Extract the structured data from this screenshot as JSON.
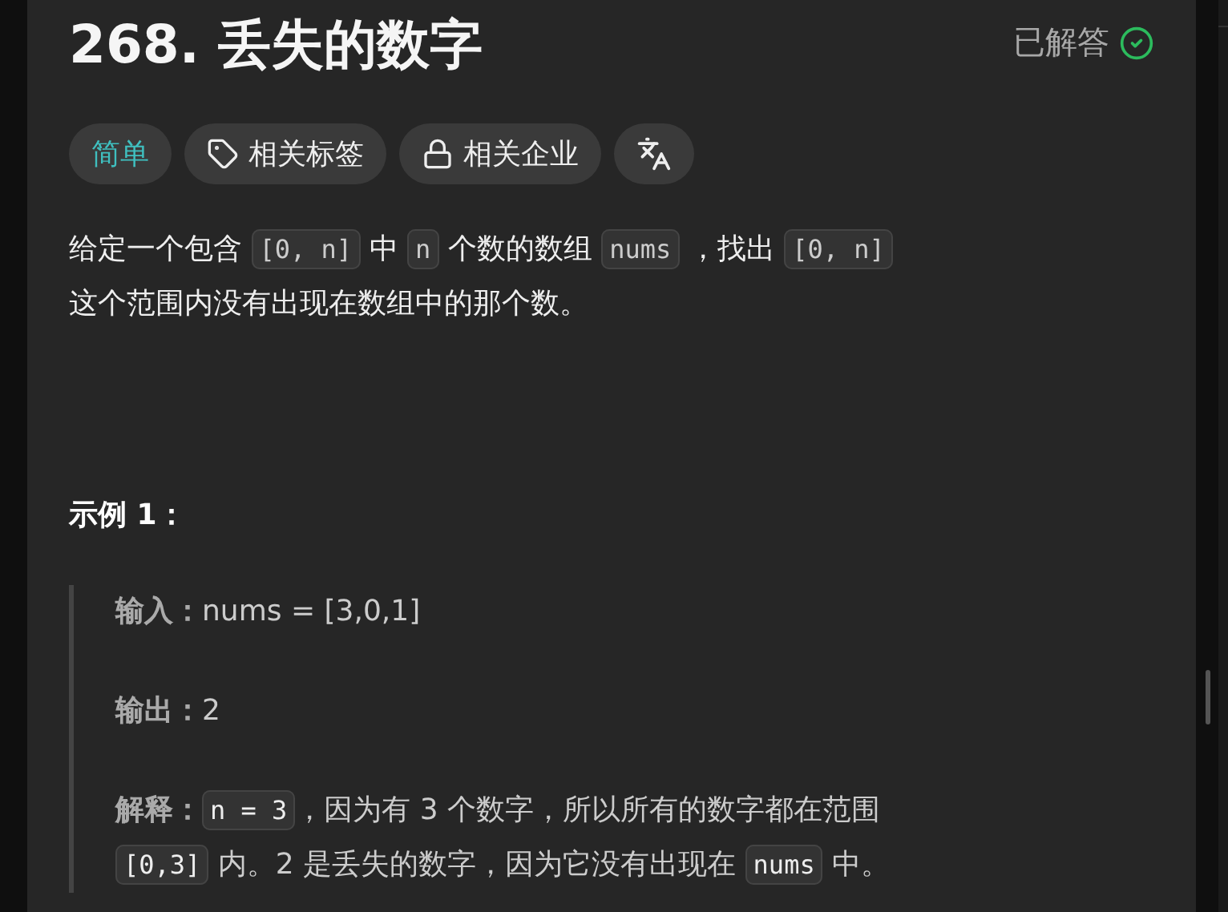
{
  "problem": {
    "title": "268. 丢失的数字",
    "status": "已解答",
    "solved": true
  },
  "tags": [
    {
      "kind": "difficulty",
      "label": "简单"
    },
    {
      "kind": "topics",
      "label": "相关标签"
    },
    {
      "kind": "companies",
      "label": "相关企业"
    },
    {
      "kind": "translate"
    }
  ],
  "description": [
    [
      {
        "kind": "text",
        "text": "给定一个包含 "
      },
      {
        "kind": "code",
        "text": "[0, n]"
      },
      {
        "kind": "text",
        "text": " 中 "
      },
      {
        "kind": "code",
        "text": "n"
      },
      {
        "kind": "text",
        "text": " 个数的数组 "
      },
      {
        "kind": "code",
        "text": "nums"
      },
      {
        "kind": "text",
        "text": " ，找出 "
      },
      {
        "kind": "code",
        "text": "[0, n]"
      }
    ],
    [
      {
        "kind": "text",
        "text": "这个范围内没有出现在数组中的那个数。"
      }
    ]
  ],
  "example": {
    "heading": "示例 1：",
    "lines": [
      {
        "label": "输入：",
        "segments": [
          {
            "kind": "text",
            "text": "nums = [3,0,1]"
          }
        ]
      },
      {
        "label": "输出：",
        "segments": [
          {
            "kind": "text",
            "text": "2"
          }
        ]
      },
      {
        "label": "解释：",
        "segments": [
          {
            "kind": "code",
            "text": "n = 3"
          },
          {
            "kind": "text",
            "text": "，因为有 3 个数字，所以所有的数字都在范围"
          }
        ],
        "more": [
          {
            "kind": "code",
            "text": "[0,3]"
          },
          {
            "kind": "text",
            "text": " 内。2 是丢失的数字，因为它没有出现在 "
          },
          {
            "kind": "code",
            "text": "nums"
          },
          {
            "kind": "text",
            "text": " 中。"
          }
        ]
      }
    ]
  }
}
